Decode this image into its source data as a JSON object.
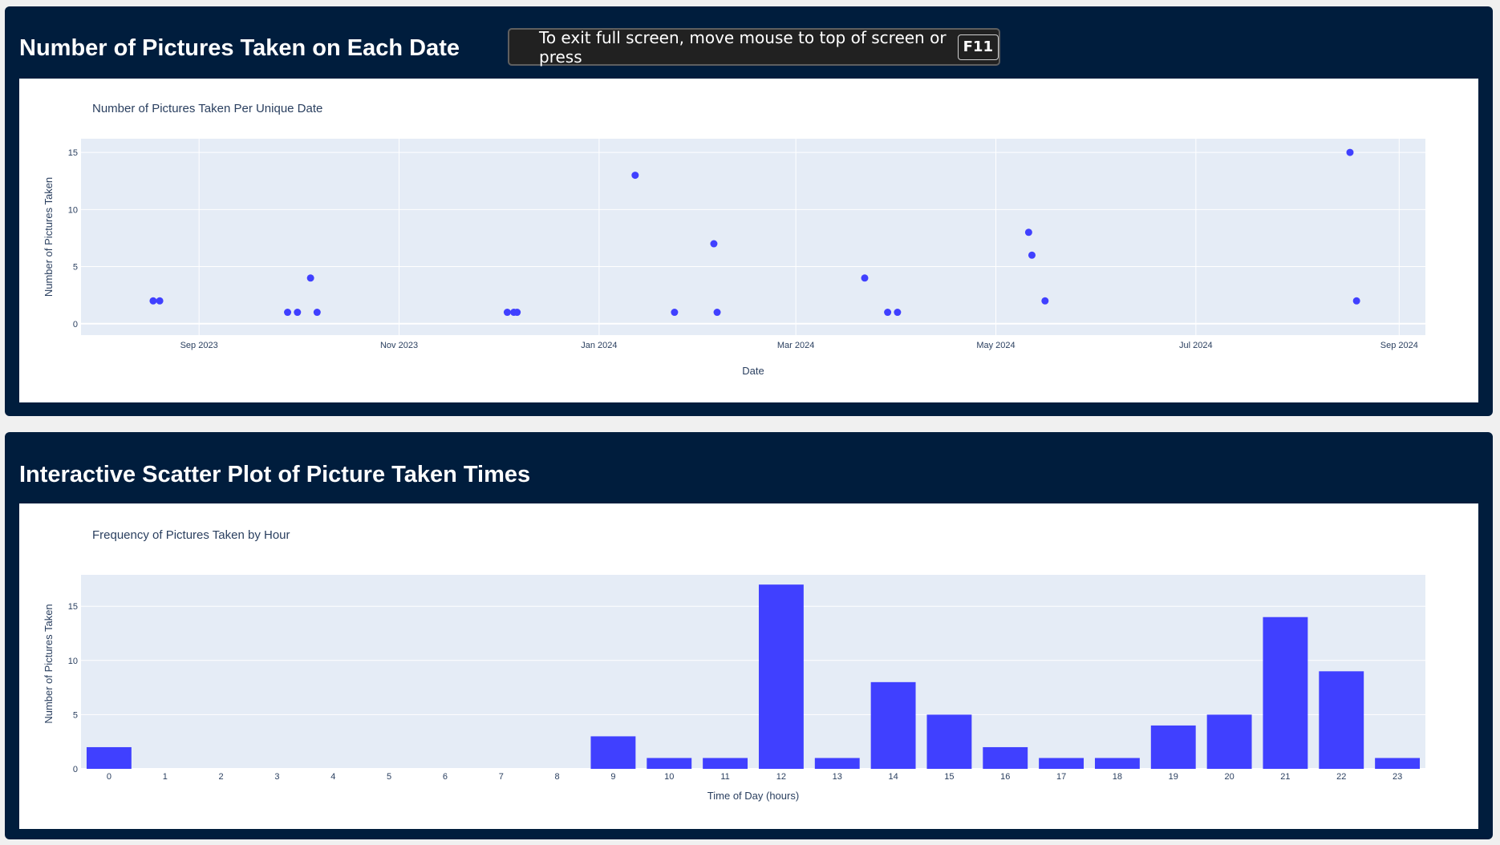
{
  "panels": {
    "scatter_heading": "Number of Pictures Taken on Each Date",
    "bar_heading": "Interactive Scatter Plot of Picture Taken Times"
  },
  "fullscreen_toast": {
    "message": "To exit full screen, move mouse to top of screen or press",
    "key": "F11"
  },
  "colors": {
    "panel_bg": "#001d3d",
    "plot_bg": "#e5ecf6",
    "marker": "#4040ff",
    "text": "#2a3f5f"
  },
  "chart_data": [
    {
      "type": "scatter",
      "title": "Number of Pictures Taken Per Unique Date",
      "xlabel": "Date",
      "ylabel": "Number of Pictures Taken",
      "x_ticks": [
        "2023-09-01",
        "2023-11-01",
        "2024-01-01",
        "2024-03-01",
        "2024-05-01",
        "2024-07-01",
        "2024-09-01"
      ],
      "x_tick_labels": [
        "Sep 2023",
        "Nov 2023",
        "Jan 2024",
        "Mar 2024",
        "May 2024",
        "Jul 2024",
        "Sep 2024"
      ],
      "xlim": [
        "2023-07-27",
        "2024-09-09"
      ],
      "ylim": [
        -1,
        16.2
      ],
      "y_ticks": [
        0,
        5,
        10,
        15
      ],
      "grid": true,
      "points": [
        {
          "x": "2023-08-18",
          "y": 2
        },
        {
          "x": "2023-08-20",
          "y": 2
        },
        {
          "x": "2023-09-28",
          "y": 1
        },
        {
          "x": "2023-10-01",
          "y": 1
        },
        {
          "x": "2023-10-05",
          "y": 4
        },
        {
          "x": "2023-10-07",
          "y": 1
        },
        {
          "x": "2023-12-04",
          "y": 1
        },
        {
          "x": "2023-12-06",
          "y": 1
        },
        {
          "x": "2023-12-07",
          "y": 1
        },
        {
          "x": "2024-01-12",
          "y": 13
        },
        {
          "x": "2024-01-24",
          "y": 1
        },
        {
          "x": "2024-02-05",
          "y": 7
        },
        {
          "x": "2024-02-06",
          "y": 1
        },
        {
          "x": "2024-03-22",
          "y": 4
        },
        {
          "x": "2024-03-29",
          "y": 1
        },
        {
          "x": "2024-04-01",
          "y": 1
        },
        {
          "x": "2024-05-11",
          "y": 8
        },
        {
          "x": "2024-05-12",
          "y": 6
        },
        {
          "x": "2024-05-16",
          "y": 2
        },
        {
          "x": "2024-08-17",
          "y": 15
        },
        {
          "x": "2024-08-19",
          "y": 2
        }
      ]
    },
    {
      "type": "bar",
      "title": "Frequency of Pictures Taken by Hour",
      "xlabel": "Time of Day (hours)",
      "ylabel": "Number of Pictures Taken",
      "categories": [
        "0",
        "1",
        "2",
        "3",
        "4",
        "5",
        "6",
        "7",
        "8",
        "9",
        "10",
        "11",
        "12",
        "13",
        "14",
        "15",
        "16",
        "17",
        "18",
        "19",
        "20",
        "21",
        "22",
        "23"
      ],
      "values": [
        2,
        0,
        0,
        0,
        0,
        0,
        0,
        0,
        0,
        3,
        1,
        1,
        17,
        1,
        8,
        5,
        2,
        1,
        1,
        4,
        5,
        14,
        9,
        1
      ],
      "ylim": [
        0,
        17.9
      ],
      "y_ticks": [
        0,
        5,
        10,
        15
      ],
      "grid": true
    }
  ]
}
